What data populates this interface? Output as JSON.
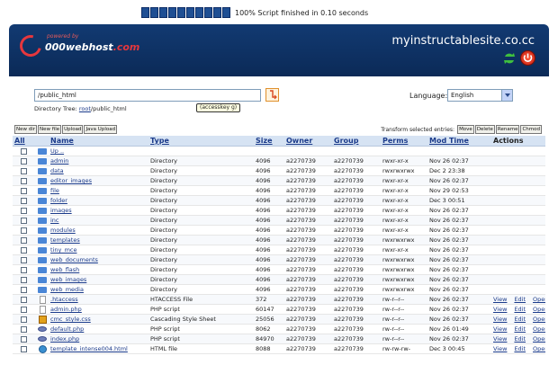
{
  "progress": {
    "blocks": 10,
    "text": "100% Script finished in 0.10 seconds"
  },
  "header": {
    "logo_powered": "powered by",
    "logo_text_main": "000webhost",
    "logo_text_suffix": ".com",
    "site_title": "myinstructablesite.co.cc"
  },
  "path": {
    "value": "/public_html",
    "tooltip": "(accesskey g)",
    "dirtree_label": "Directory Tree:",
    "dirtree_root": "root",
    "dirtree_rest": "/public_html"
  },
  "language": {
    "label": "Language:",
    "selected": "English"
  },
  "toolbar": {
    "new_dir": "New dir",
    "new_file": "New file",
    "upload": "Upload",
    "java_upload": "Java Upload"
  },
  "transform": {
    "label": "Transform selected entries:",
    "move": "Move",
    "delete": "Delete",
    "rename": "Rename",
    "chmod": "Chmod"
  },
  "table": {
    "headers": {
      "all": "All",
      "name": "Name",
      "type": "Type",
      "size": "Size",
      "owner": "Owner",
      "group": "Group",
      "perms": "Perms",
      "mod_time": "Mod Time",
      "actions": "Actions"
    },
    "actions": {
      "view": "View",
      "edit": "Edit",
      "open": "Open"
    },
    "rows": [
      {
        "icon": "folder-icon",
        "name": "Up ..",
        "type": "",
        "size": "",
        "owner": "",
        "group": "",
        "perms": "",
        "mod": ""
      },
      {
        "icon": "folder-icon",
        "name": "admin",
        "type": "Directory",
        "size": "4096",
        "owner": "a2270739",
        "group": "a2270739",
        "perms": "rwxr-xr-x",
        "mod": "Nov 26 02:37"
      },
      {
        "icon": "folder-icon",
        "name": "data",
        "type": "Directory",
        "size": "4096",
        "owner": "a2270739",
        "group": "a2270739",
        "perms": "rwxrwxrwx",
        "mod": "Dec 2 23:38"
      },
      {
        "icon": "folder-icon",
        "name": "editor_images",
        "type": "Directory",
        "size": "4096",
        "owner": "a2270739",
        "group": "a2270739",
        "perms": "rwxr-xr-x",
        "mod": "Nov 26 02:37"
      },
      {
        "icon": "folder-icon",
        "name": "file",
        "type": "Directory",
        "size": "4096",
        "owner": "a2270739",
        "group": "a2270739",
        "perms": "rwxr-xr-x",
        "mod": "Nov 29 02:53"
      },
      {
        "icon": "folder-icon",
        "name": "folder",
        "type": "Directory",
        "size": "4096",
        "owner": "a2270739",
        "group": "a2270739",
        "perms": "rwxr-xr-x",
        "mod": "Dec 3 00:51"
      },
      {
        "icon": "folder-icon",
        "name": "images",
        "type": "Directory",
        "size": "4096",
        "owner": "a2270739",
        "group": "a2270739",
        "perms": "rwxr-xr-x",
        "mod": "Nov 26 02:37"
      },
      {
        "icon": "folder-icon",
        "name": "inc",
        "type": "Directory",
        "size": "4096",
        "owner": "a2270739",
        "group": "a2270739",
        "perms": "rwxr-xr-x",
        "mod": "Nov 26 02:37"
      },
      {
        "icon": "folder-icon",
        "name": "modules",
        "type": "Directory",
        "size": "4096",
        "owner": "a2270739",
        "group": "a2270739",
        "perms": "rwxr-xr-x",
        "mod": "Nov 26 02:37"
      },
      {
        "icon": "folder-icon",
        "name": "templates",
        "type": "Directory",
        "size": "4096",
        "owner": "a2270739",
        "group": "a2270739",
        "perms": "rwxrwxrwx",
        "mod": "Nov 26 02:37"
      },
      {
        "icon": "folder-icon",
        "name": "tiny_mce",
        "type": "Directory",
        "size": "4096",
        "owner": "a2270739",
        "group": "a2270739",
        "perms": "rwxr-xr-x",
        "mod": "Nov 26 02:37"
      },
      {
        "icon": "folder-icon",
        "name": "web_documents",
        "type": "Directory",
        "size": "4096",
        "owner": "a2270739",
        "group": "a2270739",
        "perms": "rwxrwxrwx",
        "mod": "Nov 26 02:37"
      },
      {
        "icon": "folder-icon",
        "name": "web_flash",
        "type": "Directory",
        "size": "4096",
        "owner": "a2270739",
        "group": "a2270739",
        "perms": "rwxrwxrwx",
        "mod": "Nov 26 02:37"
      },
      {
        "icon": "folder-icon",
        "name": "web_images",
        "type": "Directory",
        "size": "4096",
        "owner": "a2270739",
        "group": "a2270739",
        "perms": "rwxrwxrwx",
        "mod": "Nov 26 02:37"
      },
      {
        "icon": "folder-icon",
        "name": "web_media",
        "type": "Directory",
        "size": "4096",
        "owner": "a2270739",
        "group": "a2270739",
        "perms": "rwxrwxrwx",
        "mod": "Nov 26 02:37"
      },
      {
        "icon": "file-icon",
        "name": ".htaccess",
        "type": "HTACCESS File",
        "size": "372",
        "owner": "a2270739",
        "group": "a2270739",
        "perms": "rw-r--r--",
        "mod": "Nov 26 02:37",
        "act": true
      },
      {
        "icon": "file-icon",
        "name": "admin.php",
        "type": "PHP script",
        "size": "60147",
        "owner": "a2270739",
        "group": "a2270739",
        "perms": "rw-r--r--",
        "mod": "Nov 26 02:37",
        "act": true
      },
      {
        "icon": "css-icon",
        "name": "cmc_style.css",
        "type": "Cascading Style Sheet",
        "size": "25056",
        "owner": "a2270739",
        "group": "a2270739",
        "perms": "rw-r--r--",
        "mod": "Nov 26 02:37",
        "act": true
      },
      {
        "icon": "php-icon",
        "name": "default.php",
        "type": "PHP script",
        "size": "8062",
        "owner": "a2270739",
        "group": "a2270739",
        "perms": "rw-r--r--",
        "mod": "Nov 26 01:49",
        "act": true
      },
      {
        "icon": "php-icon",
        "name": "index.php",
        "type": "PHP script",
        "size": "84970",
        "owner": "a2270739",
        "group": "a2270739",
        "perms": "rw-r--r--",
        "mod": "Nov 26 02:37",
        "act": true
      },
      {
        "icon": "html-icon",
        "name": "template_intense004.html",
        "type": "HTML file",
        "size": "8088",
        "owner": "a2270739",
        "group": "a2270739",
        "perms": "rw-rw-rw-",
        "mod": "Dec 3 00:45",
        "act": true
      }
    ]
  }
}
